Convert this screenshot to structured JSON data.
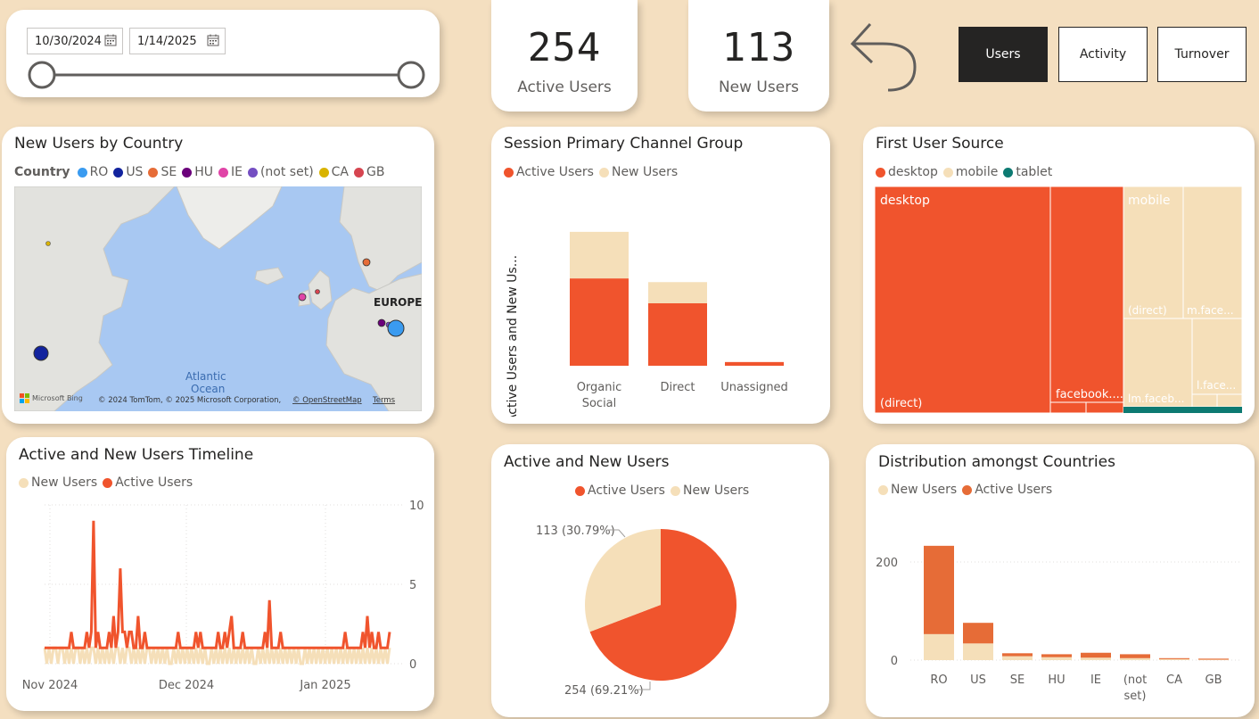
{
  "colors": {
    "active": "#F0542D",
    "new": "#F5DFB9",
    "desktop": "#F0542D",
    "mobile": "#F5DFB9",
    "tablet": "#0D7A72",
    "country_bar": "#E66C37",
    "background": "#F4DFC0"
  },
  "date_slicer": {
    "start": "10/30/2024",
    "end": "1/14/2025",
    "icon": "calendar-icon"
  },
  "kpis": {
    "active_users": {
      "value": "254",
      "label": "Active Users"
    },
    "new_users": {
      "value": "113",
      "label": "New Users"
    }
  },
  "nav": {
    "back_icon": "back-arrow-icon",
    "users": "Users",
    "activity": "Activity",
    "turnover": "Turnover",
    "selected": "Users"
  },
  "map_card": {
    "title": "New Users by Country",
    "legend_title": "Country",
    "legend": [
      {
        "name": "RO",
        "color": "#3A9BF0"
      },
      {
        "name": "US",
        "color": "#12239E"
      },
      {
        "name": "SE",
        "color": "#E66C37"
      },
      {
        "name": "HU",
        "color": "#6B007B"
      },
      {
        "name": "IE",
        "color": "#E044A7"
      },
      {
        "name": "(not set)",
        "color": "#744EC2"
      },
      {
        "name": "CA",
        "color": "#D9B300"
      },
      {
        "name": "GB",
        "color": "#D64550"
      }
    ],
    "labels": {
      "europe": "EUROPE",
      "ocean_1": "Atlantic",
      "ocean_2": "Ocean",
      "bing": "Microsoft Bing",
      "copyright": "© 2024 TomTom, © 2025 Microsoft Corporation,",
      "osm": "© OpenStreetMap",
      "terms": "Terms"
    }
  },
  "channel_card": {
    "title": "Session Primary Channel Group",
    "legend": [
      "Active Users",
      "New Users"
    ],
    "ylabel": "Active Users and New Us..."
  },
  "treemap_card": {
    "title": "First User Source",
    "legend": [
      "desktop",
      "mobile",
      "tablet"
    ],
    "labels": {
      "desktop": "desktop",
      "desktop_direct": "(direct)",
      "desktop_facebook": "facebook....",
      "mobile": "mobile",
      "mobile_direct": "(direct)",
      "mobile_mface": "m.face...",
      "mobile_lmface": "lm.faceb...",
      "mobile_lface": "l.face..."
    }
  },
  "timeline_card": {
    "title": "Active and New Users Timeline",
    "legend": [
      "New Users",
      "Active Users"
    ]
  },
  "pie_card": {
    "title": "Active and New Users",
    "legend": [
      "Active Users",
      "New Users"
    ],
    "label_new": "113 (30.79%)",
    "label_active": "254 (69.21%)"
  },
  "dist_card": {
    "title": "Distribution amongst Countries",
    "legend": [
      "New Users",
      "Active Users"
    ]
  },
  "chart_data": [
    {
      "type": "bar",
      "title": "Session Primary Channel Group",
      "stacked": true,
      "categories": [
        "Organic Social",
        "Direct",
        "Unassigned"
      ],
      "category_lines": [
        [
          "Organic",
          "Social"
        ],
        [
          "Direct"
        ],
        [
          "Unassigned"
        ]
      ],
      "series": [
        {
          "name": "Active Users",
          "values": [
            165,
            118,
            7
          ]
        },
        {
          "name": "New Users",
          "values": [
            88,
            40,
            0
          ]
        }
      ],
      "ylabel": "Active Users and New Us...",
      "ylim": [
        0,
        300
      ],
      "grid": false,
      "legend": "top-left"
    },
    {
      "type": "treemap",
      "title": "First User Source",
      "series": [
        {
          "name": "desktop",
          "values": [
            {
              "label": "(direct)",
              "value": 115
            },
            {
              "label": "facebook....",
              "value": 49
            }
          ]
        },
        {
          "name": "mobile",
          "values": [
            {
              "label": "(direct)",
              "value": 37
            },
            {
              "label": "m.face...",
              "value": 26
            },
            {
              "label": "lm.faceb...",
              "value": 22
            },
            {
              "label": "l.face...",
              "value": 10
            }
          ]
        },
        {
          "name": "tablet",
          "values": [
            {
              "label": "",
              "value": 2
            }
          ]
        }
      ],
      "legend": "top-left"
    },
    {
      "type": "line",
      "title": "Active and New Users Timeline",
      "x_ticks": [
        "Nov 2024",
        "Dec 2024",
        "Jan 2025"
      ],
      "y_ticks": [
        0,
        5,
        10
      ],
      "ylim": [
        0,
        10
      ],
      "x_range": [
        "2024-10-30",
        "2025-01-14"
      ],
      "series": [
        {
          "name": "Active Users",
          "values": [
            1,
            1,
            1,
            1,
            1,
            1,
            1,
            1,
            1,
            1,
            1,
            1,
            2,
            1,
            1,
            1,
            1,
            1,
            1,
            2,
            1,
            2,
            9,
            1,
            2,
            1,
            1,
            1,
            1,
            2,
            1,
            3,
            1,
            2,
            6,
            2,
            2,
            1,
            2,
            2,
            1,
            1,
            3,
            1,
            1,
            2,
            1,
            1,
            1,
            1,
            1,
            1,
            1,
            1,
            1,
            1,
            1,
            1,
            1,
            1,
            2,
            1,
            1,
            1,
            1,
            1,
            1,
            1,
            2,
            1,
            2,
            1,
            1,
            1,
            1,
            1,
            1,
            1,
            2,
            1,
            1,
            2,
            1,
            2,
            3,
            1,
            1,
            1,
            1,
            2,
            1,
            1,
            1,
            1,
            1,
            1,
            1,
            1,
            1,
            2,
            1,
            4,
            1,
            1,
            1,
            1,
            2,
            1,
            1,
            1,
            1,
            1,
            1,
            1,
            1,
            1,
            1,
            1,
            1,
            1,
            1,
            1,
            1,
            1,
            1,
            1,
            1,
            1,
            1,
            1,
            1,
            1,
            1,
            1,
            1,
            2,
            1,
            1,
            1,
            1,
            1,
            1,
            1,
            2,
            1,
            3,
            1,
            2,
            1,
            1,
            2,
            1,
            1,
            1,
            1,
            2
          ]
        },
        {
          "name": "New Users",
          "values": [
            1,
            0,
            1,
            0,
            1,
            1,
            0,
            1,
            1,
            0,
            1,
            0,
            1,
            0,
            1,
            1,
            0,
            1,
            0,
            1,
            0,
            1,
            1,
            0,
            1,
            0,
            1,
            0,
            1,
            0,
            1,
            0,
            1,
            1,
            0,
            1,
            0,
            1,
            1,
            0,
            1,
            0,
            1,
            0,
            1,
            0,
            1,
            1,
            0,
            1,
            0,
            1,
            0,
            1,
            0,
            1,
            0,
            0,
            1,
            0,
            1,
            0,
            1,
            0,
            1,
            0,
            1,
            0,
            1,
            0,
            1,
            0,
            1,
            0,
            0,
            1,
            0,
            1,
            0,
            1,
            0,
            1,
            0,
            1,
            0,
            1,
            0,
            1,
            0,
            1,
            0,
            1,
            0,
            1,
            0,
            0,
            1,
            0,
            1,
            0,
            1,
            0,
            1,
            0,
            1,
            0,
            1,
            0,
            1,
            0,
            1,
            0,
            1,
            0,
            1,
            0,
            0,
            1,
            0,
            1,
            0,
            1,
            0,
            1,
            0,
            1,
            0,
            1,
            0,
            1,
            0,
            1,
            0,
            1,
            0,
            1,
            0,
            1,
            0,
            1,
            0,
            1,
            0,
            1,
            0,
            1,
            0,
            1,
            0,
            1,
            0,
            1,
            0,
            1,
            0,
            1
          ]
        }
      ],
      "grid": true,
      "legend": "top-left"
    },
    {
      "type": "pie",
      "title": "Active and New Users",
      "series": [
        {
          "name": "Active Users",
          "values": [
            254
          ]
        },
        {
          "name": "New Users",
          "values": [
            113
          ]
        }
      ],
      "data_labels": [
        "254 (69.21%)",
        "113 (30.79%)"
      ],
      "legend": "top-center"
    },
    {
      "type": "bar",
      "title": "Distribution amongst Countries",
      "stacked": true,
      "categories": [
        "RO",
        "US",
        "SE",
        "HU",
        "IE",
        "(not set)",
        "CA",
        "GB"
      ],
      "category_lines": [
        [
          "RO"
        ],
        [
          "US"
        ],
        [
          "SE"
        ],
        [
          "HU"
        ],
        [
          "IE"
        ],
        [
          "(not",
          "set)"
        ],
        [
          "CA"
        ],
        [
          "GB"
        ]
      ],
      "series": [
        {
          "name": "New Users",
          "values": [
            53,
            34,
            8,
            6,
            5,
            4,
            2,
            1
          ]
        },
        {
          "name": "Active Users",
          "values": [
            180,
            42,
            6,
            6,
            10,
            8,
            2,
            2
          ]
        }
      ],
      "y_ticks": [
        0,
        200
      ],
      "ylim": [
        0,
        240
      ],
      "grid": true,
      "legend": "top-left"
    }
  ]
}
